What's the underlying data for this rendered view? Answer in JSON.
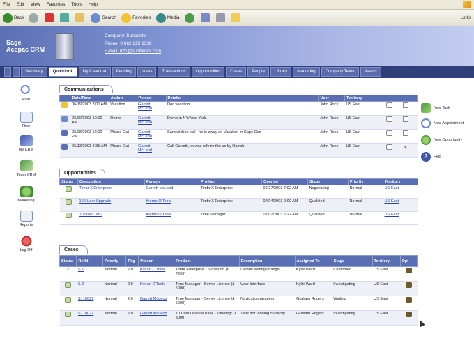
{
  "menu": [
    "File",
    "Edit",
    "View",
    "Favorites",
    "Tools",
    "Help"
  ],
  "toolbar": {
    "back": "Back",
    "search": "Search",
    "favorites": "Favorites",
    "media": "Media",
    "links": "Links"
  },
  "banner": {
    "logo_line1": "Sage",
    "logo_line2": "Accpac CRM",
    "company": "Company: Sunbanks",
    "phone": "Phone: 0 662 225 1336",
    "email": "E-mail: info@sunbanks.com"
  },
  "nav_tabs": [
    "Summary",
    "Quicklook",
    "My Calendar",
    "Pending",
    "Notes",
    "Transactions",
    "Opportunities",
    "Cases",
    "People",
    "Library",
    "Marketing",
    "Company Team",
    "Assets"
  ],
  "nav_active": "Quicklook",
  "sidebar": [
    {
      "label": "Find",
      "icon": "magnifier-icon"
    },
    {
      "label": "New",
      "icon": "new-document-icon"
    },
    {
      "label": "My CRM",
      "icon": "telescope-icon"
    },
    {
      "label": "Team CRM",
      "icon": "team-icon"
    },
    {
      "label": "Marketing",
      "icon": "globe-icon"
    },
    {
      "label": "Reports",
      "icon": "report-icon"
    },
    {
      "label": "Log Off",
      "icon": "logoff-icon"
    }
  ],
  "communications": {
    "title": "Communications",
    "headers": [
      "",
      "Date/Time",
      "Action",
      "Person",
      "Details",
      "User",
      "Territory",
      "",
      ""
    ],
    "rows": [
      {
        "date": "06/19/2003 7:00 AM",
        "action": "Vacation",
        "person": "Garrett McLeod",
        "details": "Doc vacation",
        "user": "John Rock",
        "territory": "US East",
        "icon": "phone-icon",
        "done": false
      },
      {
        "date": "06/09/2003 10:00 AM",
        "action": "Demo",
        "person": "Garrett McLeod",
        "details": "Demo in NY/New York.",
        "user": "John Rock",
        "territory": "US East",
        "icon": "calendar-icon",
        "done": false
      },
      {
        "date": "06/08/2003 12:00 PM",
        "action": "Phone Out",
        "person": "Garrett McLeod",
        "details": "Sandwiched call , he is away on Vacation in Cape Cod",
        "user": "John Rock",
        "territory": "US East",
        "icon": "phone-out-icon",
        "done": false
      },
      {
        "date": "06/13/2003 9:35 AM",
        "action": "Phone Out",
        "person": "Garrett McLeod",
        "details": "Call Garrett ,he was referred to us by Harrah.",
        "user": "John Rock",
        "territory": "US East",
        "icon": "phone-out-icon",
        "done": true
      }
    ]
  },
  "opportunities": {
    "title": "Opportunities",
    "headers": [
      "Status",
      "Description",
      "Person",
      "Product",
      "Opened",
      "Stage",
      "Priority",
      "Territory"
    ],
    "rows": [
      {
        "description": "Timbr X Enterprise",
        "person": "Garrett McLeod",
        "product": "Timbr X Enterprise",
        "opened": "06/27/2003 7:02 AM",
        "stage": "Negotiating",
        "priority": "Normal",
        "territory": "US East"
      },
      {
        "description": "100 User Upgrade",
        "person": "Kieran O'Toole",
        "product": "Timbr X Enterprise",
        "opened": "02/04/2003 9:00 AM",
        "stage": "Qualified",
        "priority": "Normal",
        "territory": "US East"
      },
      {
        "description": "10 User TMG",
        "person": "Kieran O'Toole",
        "product": "Time Manager",
        "opened": "02/07/2003 6:22 AM",
        "stage": "Qualified",
        "priority": "Normal",
        "territory": "US East"
      }
    ]
  },
  "cases": {
    "title": "Cases",
    "headers": [
      "Status",
      "RefId",
      "Priority",
      "Pkg",
      "Person",
      "Product",
      "Description",
      "Assigned To",
      "Stage",
      "Territory",
      "Opt"
    ],
    "rows": [
      {
        "ref": "S.1",
        "priority": "Normal",
        "pkg": "2.0",
        "person": "Kieran O'Toole",
        "product": "Timbr Enterprise - Server on (£ 7999)",
        "description": "Default setting change",
        "assigned": "Kylie Ward",
        "stage": "Confirmed",
        "territory": "US East"
      },
      {
        "ref": "S.2",
        "priority": "Normal",
        "pkg": "2.0",
        "person": "Kieran O'Toole",
        "product": "Time Manager - Server Licence (£ 5000)",
        "description": "User Interface",
        "assigned": "Kylie Ward",
        "stage": "Investigating",
        "territory": "US East"
      },
      {
        "ref": "S. 10021",
        "priority": "Normal",
        "pkg": "2.0",
        "person": "Garrett McLeod",
        "product": "Time Manager - Server Licence (£ 5000)",
        "description": "Navigation problem",
        "assigned": "Graham Rogers",
        "stage": "Waiting",
        "territory": "US East"
      },
      {
        "ref": "S. 10021",
        "priority": "Normal",
        "pkg": "2.0",
        "person": "Garrett McLeod",
        "product": "10 User Licence Pack - TimeMgr (£ 3000)",
        "description": "Tabs not tabbing correctly",
        "assigned": "Graham Rogers",
        "stage": "Investigating",
        "territory": "US East"
      }
    ]
  },
  "right_actions": [
    {
      "label": "New Task",
      "icon": "new-task-icon"
    },
    {
      "label": "New Appointment",
      "icon": "new-appointment-icon"
    },
    {
      "label": "New Opportunity",
      "icon": "new-opportunity-icon"
    },
    {
      "label": "Help",
      "icon": "help-icon"
    }
  ]
}
